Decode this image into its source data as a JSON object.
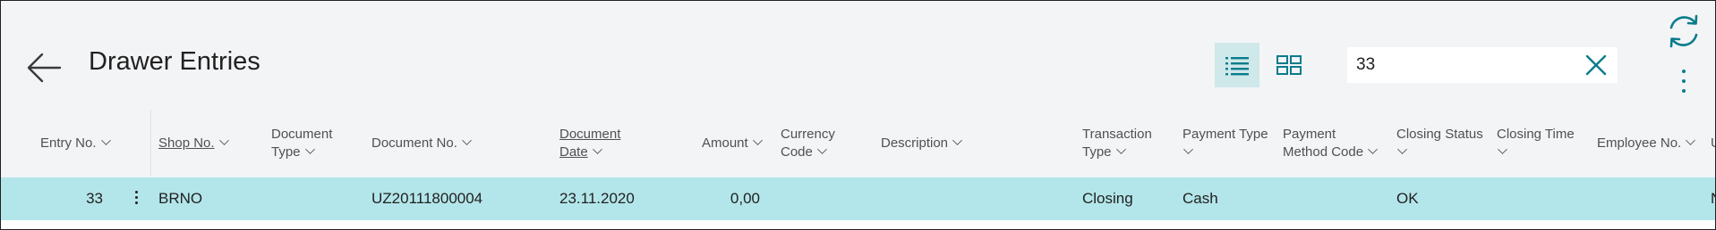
{
  "page": {
    "title": "Drawer Entries"
  },
  "search": {
    "value": "33"
  },
  "colors": {
    "accent": "#0a7c8c",
    "selected_row": "#b3e6ea",
    "active_view": "#cfe8ea"
  },
  "icons": {
    "back": "back-arrow-icon",
    "list_view": "list-view-icon",
    "tile_view": "tile-view-icon",
    "clear": "close-icon",
    "refresh": "refresh-icon",
    "more": "more-vertical-icon",
    "row_menu": "row-menu-icon"
  },
  "columns": {
    "entry_no": "Entry No.",
    "shop_no": "Shop No.",
    "document_type_1": "Document",
    "document_type_2": "Type",
    "document_no": "Document No.",
    "document_date_1": "Document",
    "document_date_2": "Date",
    "amount": "Amount",
    "currency_code_1": "Currency",
    "currency_code_2": "Code",
    "description": "Description",
    "transaction_type_1": "Transaction",
    "transaction_type_2": "Type",
    "payment_type": "Payment Type",
    "payment_method_code_1": "Payment",
    "payment_method_code_2": "Method Code",
    "closing_status": "Closing Status",
    "closing_time": "Closing Time",
    "employee_no": "Employee No.",
    "next_partial": "U"
  },
  "rows": [
    {
      "entry_no": "33",
      "shop_no": "BRNO",
      "document_type": "",
      "document_no": "UZ20111800004",
      "document_date": "23.11.2020",
      "amount": "0,00",
      "currency_code": "",
      "description": "",
      "transaction_type": "Closing",
      "payment_type": "Cash",
      "payment_method_code": "",
      "closing_status": "OK",
      "closing_time": "",
      "employee_no": "",
      "next_partial": "N"
    }
  ]
}
